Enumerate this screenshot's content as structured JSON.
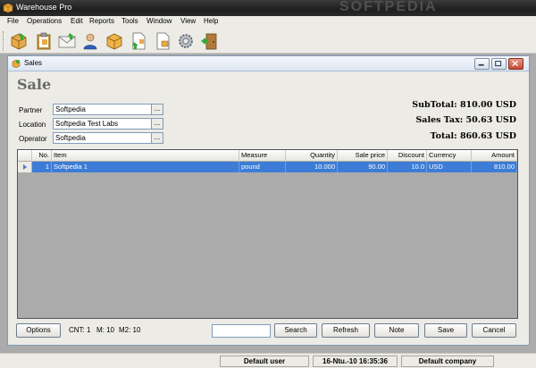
{
  "app": {
    "title": "Warehouse Pro",
    "watermark": "SOFTPEDIA"
  },
  "menu": {
    "items": [
      "File",
      "Operations",
      "Edit",
      "Reports",
      "Tools",
      "Window",
      "View",
      "Help"
    ]
  },
  "toolbar": {
    "icons": [
      "box-icon",
      "clipboard-icon",
      "envelope-icon",
      "user-icon",
      "package-icon",
      "document-arrow-icon",
      "document-icon",
      "gear-icon",
      "exit-door-icon"
    ]
  },
  "child": {
    "title": "Sales",
    "heading": "Sale"
  },
  "fields": {
    "partner_label": "Partner",
    "partner_value": "Softpedia",
    "location_label": "Location",
    "location_value": "Softpedia Test Labs",
    "operator_label": "Operator",
    "operator_value": "Softpedia",
    "ellipsis": "..."
  },
  "totals": {
    "subtotal": "SubTotal: 810.00 USD",
    "tax": "Sales Tax: 50.63 USD",
    "total": "Total: 860.63 USD"
  },
  "grid": {
    "columns": [
      "No.",
      "Item",
      "Measure",
      "Quantity",
      "Sale price",
      "Discount",
      "Currency",
      "Amount"
    ],
    "rows": [
      {
        "no": "1",
        "item": "Softpedia 1",
        "measure": "pound",
        "quantity": "10.000",
        "price": "90.00",
        "discount": "10.0",
        "currency": "USD",
        "amount": "810.00"
      }
    ]
  },
  "bottom": {
    "options": "Options",
    "cnt": "CNT: 1",
    "m": "M: 10",
    "m2": "M2: 10",
    "search": "Search",
    "refresh": "Refresh",
    "note": "Note",
    "save": "Save",
    "cancel": "Cancel"
  },
  "status": {
    "user": "Default user",
    "datetime": "16-Ntu.-10 16:35:36",
    "company": "Default company"
  }
}
